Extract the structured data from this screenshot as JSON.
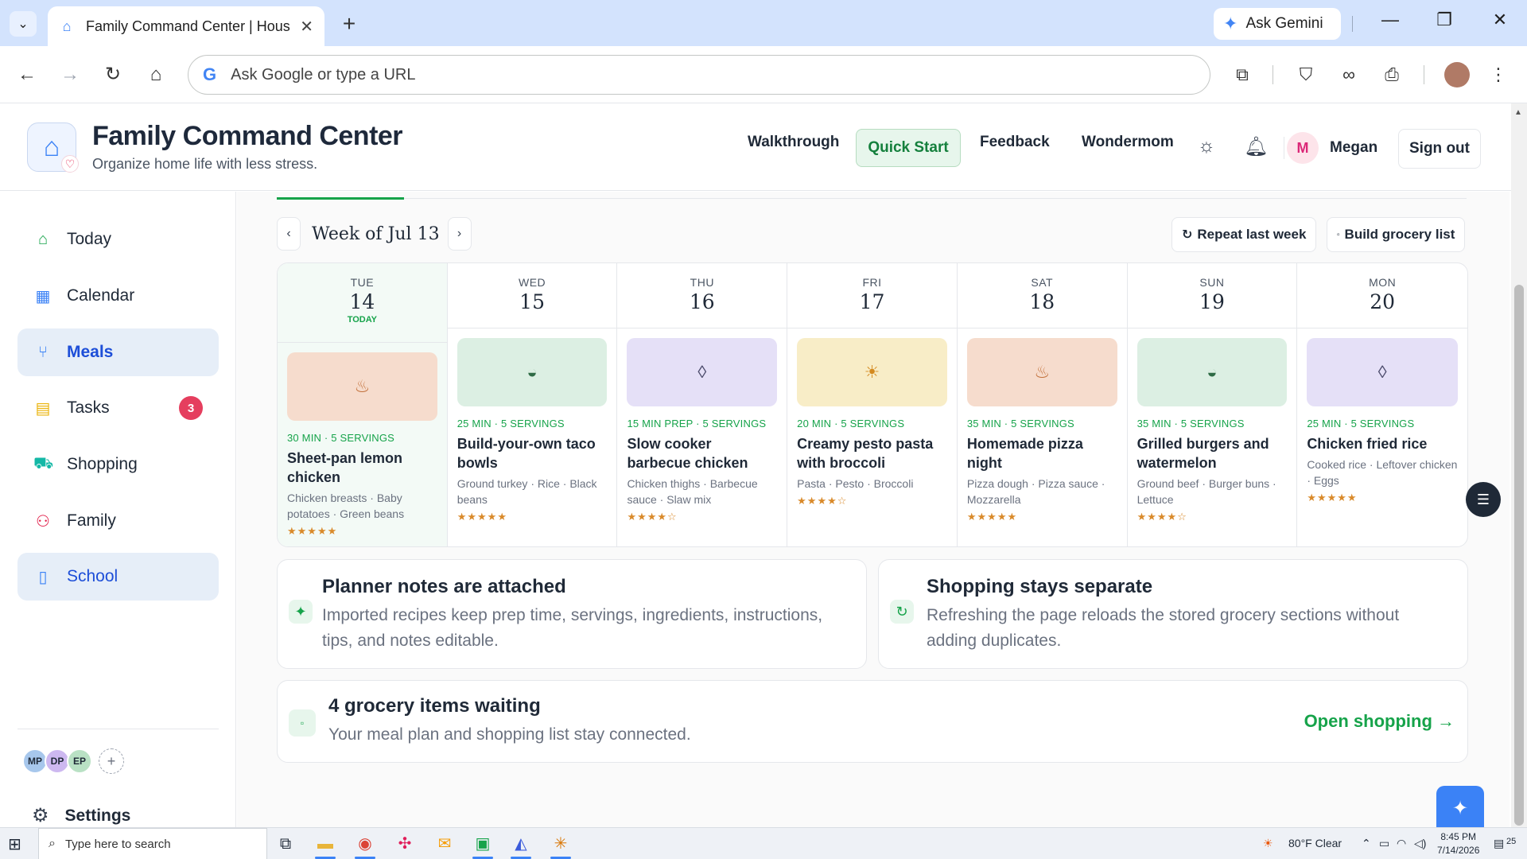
{
  "browser": {
    "tab_title": "Family Command Center | Hous",
    "ask_gemini": "Ask Gemini",
    "omnibox_placeholder": "Ask Google or type a URL"
  },
  "header": {
    "title": "Family Command Center",
    "subtitle": "Organize home life with less stress.",
    "nav": [
      "Walkthrough",
      "Quick Start",
      "Feedback",
      "Wondermom"
    ],
    "user_initial": "M",
    "user_name": "Megan",
    "sign_out": "Sign out"
  },
  "sidebar": {
    "items": [
      {
        "label": "Today",
        "icon": "home-icon",
        "color": "#16a34a"
      },
      {
        "label": "Calendar",
        "icon": "calendar-icon",
        "color": "#3b82f6"
      },
      {
        "label": "Meals",
        "icon": "utensils-icon",
        "color": "#3b82f6",
        "active": true
      },
      {
        "label": "Tasks",
        "icon": "clipboard-icon",
        "color": "#eab308",
        "badge": "3"
      },
      {
        "label": "Shopping",
        "icon": "cart-icon",
        "color": "#14b8a6"
      },
      {
        "label": "Family",
        "icon": "people-icon",
        "color": "#e11d48"
      },
      {
        "label": "School",
        "icon": "book-icon",
        "color": "#3b82f6",
        "active": true
      }
    ],
    "members": [
      {
        "initials": "MP",
        "color": "#a7c7ec"
      },
      {
        "initials": "DP",
        "color": "#cdb8f0"
      },
      {
        "initials": "EP",
        "color": "#b9e1c4"
      }
    ],
    "settings": "Settings"
  },
  "planner": {
    "week_label": "Week of Jul 13",
    "repeat_btn": "Repeat last week",
    "grocery_btn": "Build grocery list",
    "today_tag": "TODAY",
    "days": [
      {
        "dow": "TUE",
        "num": "14",
        "today": true,
        "bg": "#f6dccd",
        "icon": "bowl-icon",
        "glyph": "♨",
        "glyph_color": "#c2703a",
        "meta": "30 MIN · 5 SERVINGS",
        "name": "Sheet-pan lemon chicken",
        "ingredients": "Chicken breasts · Baby potatoes · Green beans",
        "stars": "★★★★★"
      },
      {
        "dow": "WED",
        "num": "15",
        "bg": "#dcefe3",
        "icon": "half-circle-icon",
        "glyph": "◒",
        "glyph_color": "#2f6b46",
        "meta": "25 MIN · 5 SERVINGS",
        "name": "Build-your-own taco bowls",
        "ingredients": "Ground turkey · Rice · Black beans",
        "stars": "★★★★★"
      },
      {
        "dow": "THU",
        "num": "16",
        "bg": "#e5e0f7",
        "icon": "diamond-icon",
        "glyph": "◊",
        "glyph_color": "#4b4b6b",
        "meta": "15 MIN PREP · 5 SERVINGS",
        "name": "Slow cooker barbecue chicken",
        "ingredients": "Chicken thighs · Barbecue sauce · Slaw mix",
        "stars": "★★★★☆"
      },
      {
        "dow": "FRI",
        "num": "17",
        "bg": "#f8edc7",
        "icon": "sun-icon",
        "glyph": "☀",
        "glyph_color": "#d48a1f",
        "meta": "20 MIN · 5 SERVINGS",
        "name": "Creamy pesto pasta with broccoli",
        "ingredients": "Pasta · Pesto · Broccoli",
        "stars": "★★★★☆"
      },
      {
        "dow": "SAT",
        "num": "18",
        "bg": "#f6dccd",
        "icon": "bowl-icon",
        "glyph": "♨",
        "glyph_color": "#c2703a",
        "meta": "35 MIN · 5 SERVINGS",
        "name": "Homemade pizza night",
        "ingredients": "Pizza dough · Pizza sauce · Mozzarella",
        "stars": "★★★★★"
      },
      {
        "dow": "SUN",
        "num": "19",
        "bg": "#dcefe3",
        "icon": "half-circle-icon",
        "glyph": "◒",
        "glyph_color": "#2f6b46",
        "meta": "35 MIN · 5 SERVINGS",
        "name": "Grilled burgers and watermelon",
        "ingredients": "Ground beef · Burger buns · Lettuce",
        "stars": "★★★★☆"
      },
      {
        "dow": "MON",
        "num": "20",
        "bg": "#e5e0f7",
        "icon": "diamond-icon",
        "glyph": "◊",
        "glyph_color": "#4b4b6b",
        "meta": "25 MIN · 5 SERVINGS",
        "name": "Chicken fried rice",
        "ingredients": "Cooked rice · Leftover chicken · Eggs",
        "stars": "★★★★★"
      }
    ]
  },
  "info_cards": [
    {
      "title": "Planner notes are attached",
      "desc": "Imported recipes keep prep time, servings, ingredients, instructions, tips, and notes editable."
    },
    {
      "title": "Shopping stays separate",
      "desc": "Refreshing the page reloads the stored grocery sections without adding duplicates."
    }
  ],
  "grocery": {
    "title": "4 grocery items waiting",
    "desc": "Your meal plan and shopping list stay connected.",
    "link": "Open shopping →"
  },
  "taskbar": {
    "search_placeholder": "Type here to search",
    "weather": "80°F  Clear",
    "time": "8:45 PM",
    "date": "7/14/2026",
    "notif_count": "25"
  }
}
